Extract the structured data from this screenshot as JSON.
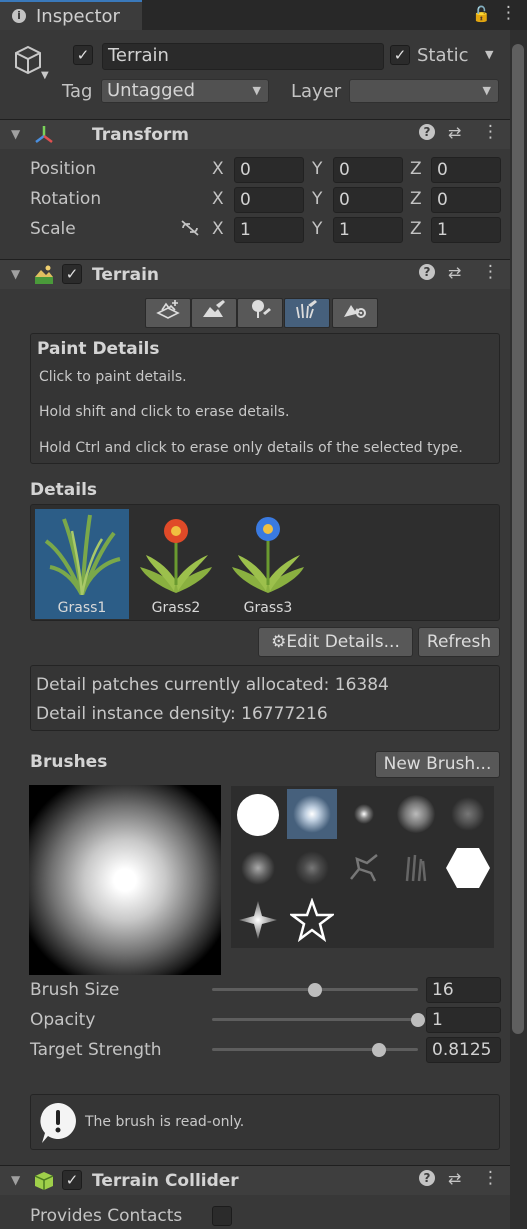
{
  "tab": {
    "title": "Inspector",
    "icon": "info-icon"
  },
  "object": {
    "name": "Terrain",
    "active": true,
    "static_label": "Static",
    "static_checked": true,
    "tag_label": "Tag",
    "tag_value": "Untagged",
    "layer_label": "Layer",
    "layer_value": ""
  },
  "transform": {
    "title": "Transform",
    "rows": [
      {
        "label": "Position",
        "x": "0",
        "y": "0",
        "z": "0"
      },
      {
        "label": "Rotation",
        "x": "0",
        "y": "0",
        "z": "0"
      },
      {
        "label": "Scale",
        "x": "1",
        "y": "1",
        "z": "1"
      }
    ],
    "axis_x": "X",
    "axis_y": "Y",
    "axis_z": "Z"
  },
  "terrain": {
    "title": "Terrain",
    "enabled": true,
    "tools": [
      "create-neighbor-icon",
      "paint-terrain-icon",
      "paint-trees-icon",
      "paint-details-icon",
      "terrain-settings-icon"
    ],
    "active_tool": 3,
    "paint_title": "Paint Details",
    "paint_lines": [
      "Click to paint details.",
      "Hold shift and click to erase details.",
      "Hold Ctrl and click to erase only details of the selected type."
    ],
    "details_label": "Details",
    "details": [
      {
        "name": "Grass1",
        "selected": true
      },
      {
        "name": "Grass2",
        "selected": false
      },
      {
        "name": "Grass3",
        "selected": false
      }
    ],
    "edit_details": "Edit Details...",
    "refresh": "Refresh",
    "info_lines": [
      "Detail patches currently allocated: 16384",
      "Detail instance density: 16777216"
    ],
    "brushes_label": "Brushes",
    "new_brush": "New Brush...",
    "sliders": [
      {
        "label": "Brush Size",
        "value": "16",
        "fraction": 0.5
      },
      {
        "label": "Opacity",
        "value": "1",
        "fraction": 1.0
      },
      {
        "label": "Target Strength",
        "value": "0.8125",
        "fraction": 0.8125
      }
    ],
    "readonly_msg": "The brush is read-only."
  },
  "collider": {
    "title": "Terrain Collider",
    "enabled": true,
    "provides_contacts": "Provides Contacts"
  },
  "colors": {
    "accent": "#3a79bb",
    "selection": "#2c5d87",
    "panel": "#383838"
  }
}
